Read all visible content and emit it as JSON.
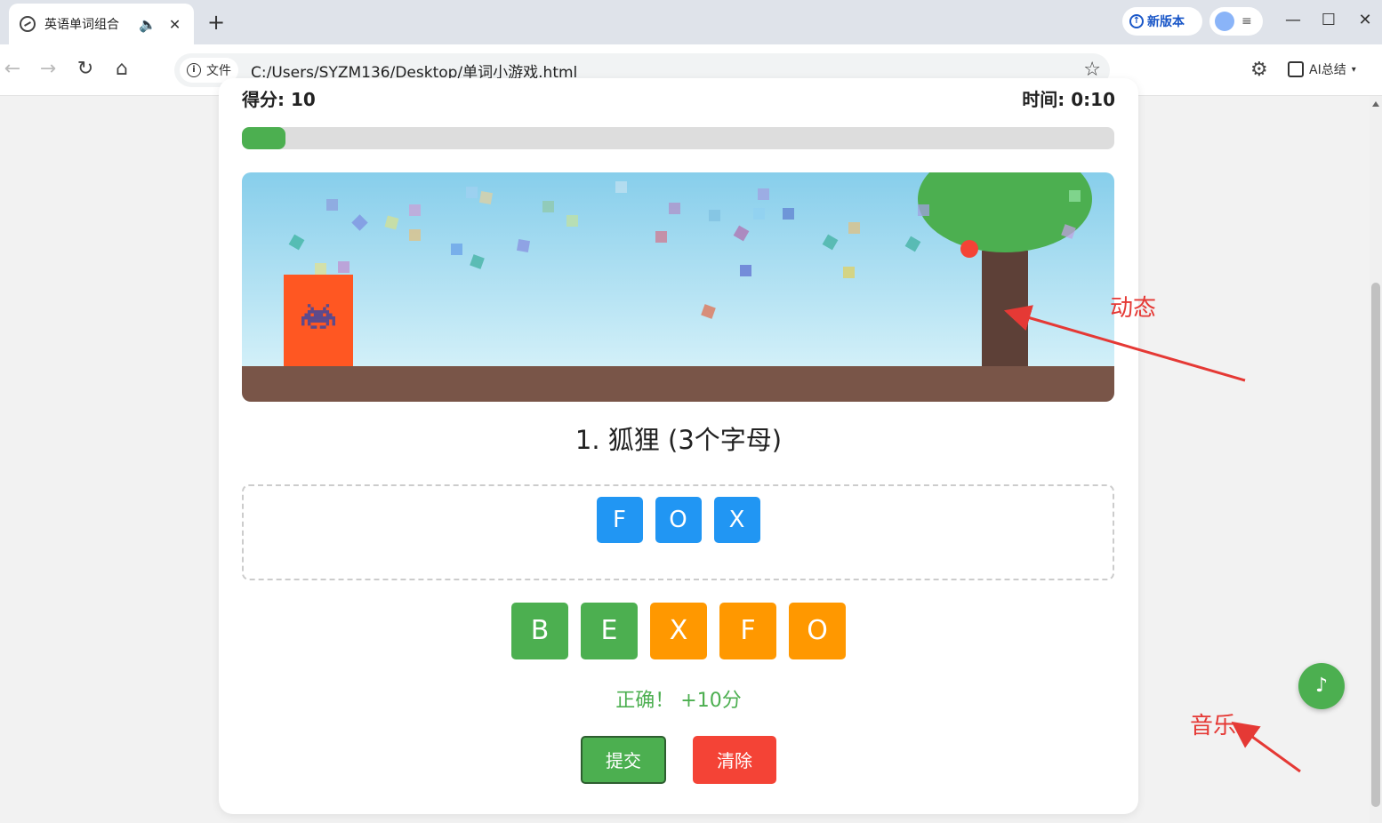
{
  "browser": {
    "tab_title": "英语单词组合",
    "tab_audio_icon": "speaker-icon",
    "new_tab_label": "+",
    "new_version_label": "新版本",
    "profile_menu_label": "≡",
    "file_chip_label": "文件",
    "url": "C:/Users/SYZM136/Desktop/单词小游戏.html",
    "ai_summary_label": "AI总结"
  },
  "game": {
    "score_label": "得分: 10",
    "time_label": "时间: 0:10",
    "progress": 0.05,
    "question": "1. 狐狸 (3个字母)",
    "answer_letters": [
      "F",
      "O",
      "X"
    ],
    "pool_letters": [
      {
        "letter": "B",
        "color": "#4caf50"
      },
      {
        "letter": "E",
        "color": "#4caf50"
      },
      {
        "letter": "X",
        "color": "#ff9800"
      },
      {
        "letter": "F",
        "color": "#ff9800"
      },
      {
        "letter": "O",
        "color": "#ff9800"
      }
    ],
    "feedback": "正确！ +10分",
    "submit_label": "提交",
    "clear_label": "清除",
    "music_label": "♪"
  },
  "annotations": {
    "dynamic_label": "动态",
    "music_label": "音乐"
  },
  "colors": {
    "accent_green": "#4caf50",
    "tile_blue": "#2196f3",
    "tile_orange": "#ff9800",
    "danger_red": "#f44336",
    "ground_brown": "#795548",
    "player_orange": "#ff5722",
    "annotation_red": "#e53935"
  }
}
